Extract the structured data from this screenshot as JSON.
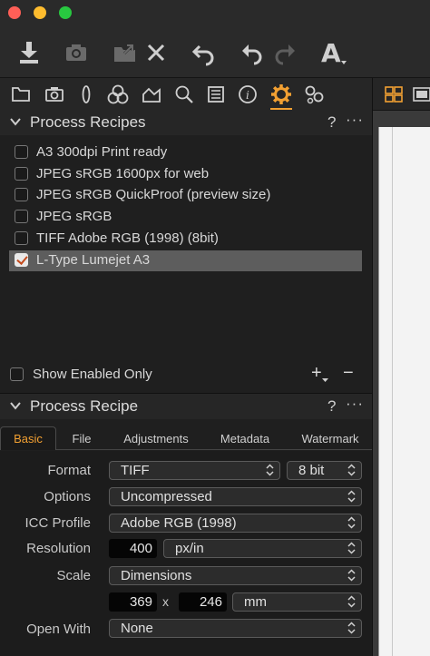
{
  "toolbar": {
    "icons": [
      "import-icon",
      "camera-icon",
      "export-icon",
      "delete-icon",
      "undo-icon",
      "undo-icon",
      "redo-icon",
      "text-annotation-icon"
    ]
  },
  "tool_tabs": [
    "library-icon",
    "capture-icon",
    "lens-icon",
    "color-icon",
    "exposure-icon",
    "details-icon",
    "metadata-icon",
    "info-icon",
    "output-icon",
    "adjustments-icon"
  ],
  "process_recipes": {
    "title": "Process Recipes",
    "help": "?",
    "menu": "···",
    "items": [
      {
        "label": "A3 300dpi Print ready",
        "checked": false
      },
      {
        "label": "JPEG sRGB 1600px for web",
        "checked": false
      },
      {
        "label": "JPEG sRGB QuickProof (preview size)",
        "checked": false
      },
      {
        "label": "JPEG sRGB",
        "checked": false
      },
      {
        "label": "TIFF Adobe RGB (1998) (8bit)",
        "checked": false
      },
      {
        "label": "L-Type Lumejet A3",
        "checked": true
      }
    ],
    "show_enabled_label": "Show Enabled Only",
    "add": "+",
    "remove": "−"
  },
  "process_recipe": {
    "title": "Process Recipe",
    "help": "?",
    "menu": "···",
    "tabs": [
      "Basic",
      "File",
      "Adjustments",
      "Metadata",
      "Watermark"
    ],
    "active_tab": "Basic",
    "format_label": "Format",
    "format_value": "TIFF",
    "bit_value": "8 bit",
    "options_label": "Options",
    "options_value": "Uncompressed",
    "icc_label": "ICC Profile",
    "icc_value": "Adobe RGB (1998)",
    "resolution_label": "Resolution",
    "resolution_value": "400",
    "resolution_unit": "px/in",
    "scale_label": "Scale",
    "scale_value": "Dimensions",
    "width_value": "369",
    "times": "x",
    "height_value": "246",
    "dim_unit": "mm",
    "open_with_label": "Open With",
    "open_with_value": "None"
  },
  "colors": {
    "accent": "#f2a032",
    "selected_row": "#5d5d5d",
    "background": "#1f1f1f"
  }
}
